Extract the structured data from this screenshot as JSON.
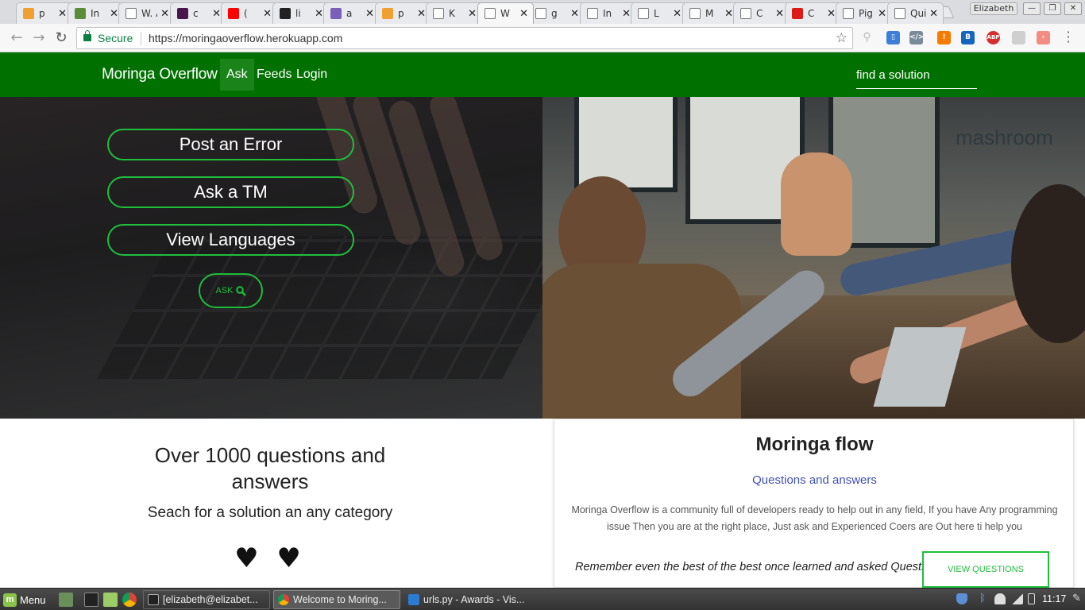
{
  "browser": {
    "tabs": [
      {
        "label": "p",
        "icon": "pig-icon",
        "color": "#f0a030"
      },
      {
        "label": "In",
        "icon": "tree-icon",
        "color": "#5b8c3a"
      },
      {
        "label": "W. A",
        "icon": "w-icon",
        "color": "#e8eaed"
      },
      {
        "label": "c",
        "icon": "slack-icon",
        "color": "#4a154b"
      },
      {
        "label": "(",
        "icon": "youtube-icon",
        "color": "#ff0000"
      },
      {
        "label": "li",
        "icon": "github-icon",
        "color": "#222222"
      },
      {
        "label": "a",
        "icon": "heroku-icon",
        "color": "#7a5fb8"
      },
      {
        "label": "p",
        "icon": "pig-icon",
        "color": "#f0a030"
      },
      {
        "label": "K",
        "icon": "page-icon",
        "color": "#e8eaed"
      },
      {
        "label": "W",
        "icon": "page-icon",
        "color": "#e8eaed"
      },
      {
        "label": "g",
        "icon": "page-icon",
        "color": "#e8eaed"
      },
      {
        "label": "In",
        "icon": "page-icon",
        "color": "#e8eaed"
      },
      {
        "label": "L",
        "icon": "page-icon",
        "color": "#e8eaed"
      },
      {
        "label": "M",
        "icon": "page-icon",
        "color": "#e8eaed"
      },
      {
        "label": "C",
        "icon": "page-icon",
        "color": "#e8eaed"
      },
      {
        "label": "C",
        "icon": "angular-icon",
        "color": "#dd1b16"
      },
      {
        "label": "Pig D",
        "icon": "page-icon",
        "color": "#e8eaed"
      },
      {
        "label": "Quiz",
        "icon": "page-icon",
        "color": "#e8eaed"
      }
    ],
    "active_tab_index": 9,
    "profile_name": "Elizabeth",
    "secure_label": "Secure",
    "url": "https://moringaoverflow.herokuapp.com"
  },
  "site": {
    "brand": "Moringa Overflow",
    "nav": {
      "ask": "Ask",
      "feeds": "Feeds",
      "login": "Login"
    },
    "search_placeholder": "find a solution",
    "hero": {
      "buttons": [
        "Post an Error",
        "Ask a TM",
        "View Languages"
      ],
      "ask_button": "ASK",
      "photo_sign": "mashroom"
    },
    "stats": {
      "headline": "Over 1000 questions and answers",
      "subline": "Seach for a solution an any category",
      "hearts": "♥ ♥"
    },
    "card": {
      "title": "Moringa flow",
      "subtitle": "Questions and answers",
      "body": "Moringa Overflow is a community full of developers ready to help out in any field, If you have Any programming issue Then you are at the right place, Just ask and Experienced Coers are Out here ti help you",
      "quote": "Remember even the best of the best once learned and asked Questions",
      "button": "VIEW QUESTIONS"
    },
    "colors": {
      "nav_green": "#007000",
      "accent_green": "#1fbf3c",
      "subtitle_blue": "#3f51b5"
    }
  },
  "taskbar": {
    "menu_label": "Menu",
    "items": [
      {
        "label": "[elizabeth@elizabet...",
        "icon": "terminal-icon"
      },
      {
        "label": "Welcome to Moring...",
        "icon": "chrome-icon"
      },
      {
        "label": "urls.py - Awards - Vis...",
        "icon": "vscode-icon"
      }
    ],
    "clock": "11:17"
  }
}
